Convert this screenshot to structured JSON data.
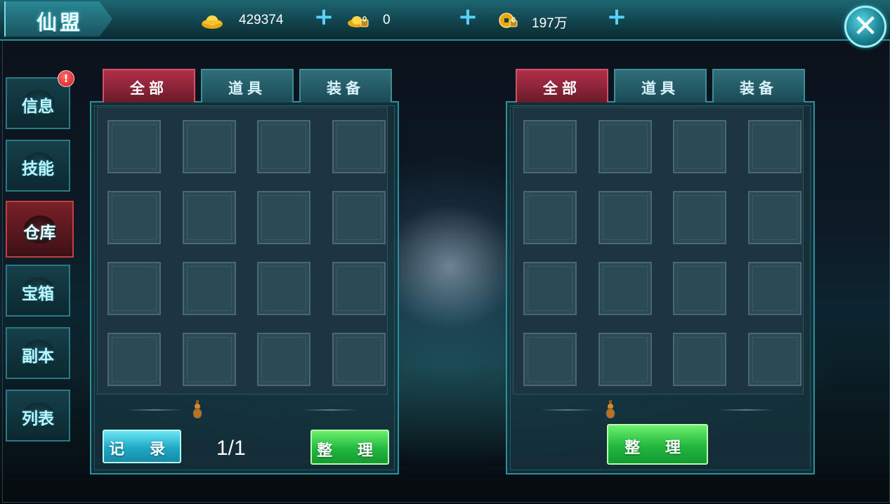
{
  "header": {
    "title": "仙盟",
    "currencies": [
      {
        "icon": "gold-ingot-icon",
        "value": "429374"
      },
      {
        "icon": "bound-ingot-icon",
        "value": "0"
      },
      {
        "icon": "bound-coin-icon",
        "value": "197万"
      }
    ],
    "add_label": "+",
    "close_label": "✕"
  },
  "sidebar": {
    "items": [
      {
        "label": "信息",
        "active": false,
        "alert": "!"
      },
      {
        "label": "技能",
        "active": false
      },
      {
        "label": "仓库",
        "active": true
      },
      {
        "label": "宝箱",
        "active": false
      },
      {
        "label": "副本",
        "active": false
      },
      {
        "label": "列表",
        "active": false
      }
    ]
  },
  "left_panel": {
    "tabs": [
      {
        "label": "全部",
        "active": true
      },
      {
        "label": "道具",
        "active": false
      },
      {
        "label": "装备",
        "active": false
      }
    ],
    "record_button": "记 录",
    "page": "1/1",
    "sort_button": "整 理"
  },
  "right_panel": {
    "tabs": [
      {
        "label": "全部",
        "active": true
      },
      {
        "label": "道具",
        "active": false
      },
      {
        "label": "装备",
        "active": false
      }
    ],
    "sort_button": "整 理"
  },
  "colors": {
    "accent_cyan": "#58d2ff",
    "active_tab_red": "#b03048",
    "button_green": "#22b840",
    "button_cyan": "#20a8c4"
  }
}
